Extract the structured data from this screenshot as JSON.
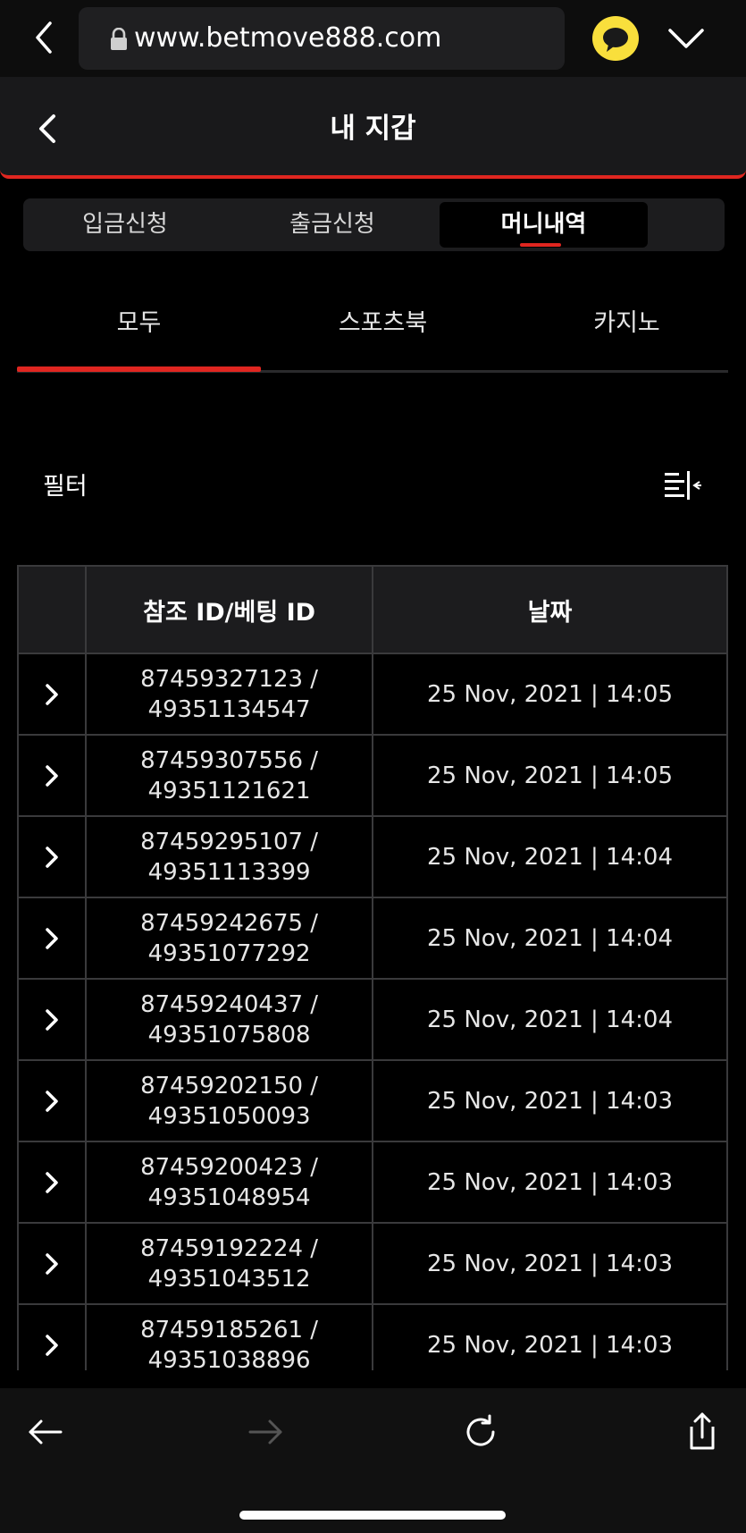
{
  "browser": {
    "url": "www.betmove888.com"
  },
  "header": {
    "title": "내 지갑"
  },
  "segment_tabs": [
    {
      "label": "입금신청",
      "active": false
    },
    {
      "label": "출금신청",
      "active": false
    },
    {
      "label": "머니내역",
      "active": true
    }
  ],
  "sub_tabs": [
    {
      "label": "모두",
      "active": true
    },
    {
      "label": "스포츠북",
      "active": false
    },
    {
      "label": "카지노",
      "active": false
    }
  ],
  "filter": {
    "label": "필터"
  },
  "table": {
    "columns": [
      "",
      "참조 ID/베팅 ID",
      "날짜"
    ],
    "rows": [
      {
        "ref_id": "87459327123 /",
        "bet_id": "49351134547",
        "date": "25 Nov, 2021 | 14:05"
      },
      {
        "ref_id": "87459307556 /",
        "bet_id": "49351121621",
        "date": "25 Nov, 2021 | 14:05"
      },
      {
        "ref_id": "87459295107 /",
        "bet_id": "49351113399",
        "date": "25 Nov, 2021 | 14:04"
      },
      {
        "ref_id": "87459242675 /",
        "bet_id": "49351077292",
        "date": "25 Nov, 2021 | 14:04"
      },
      {
        "ref_id": "87459240437 /",
        "bet_id": "49351075808",
        "date": "25 Nov, 2021 | 14:04"
      },
      {
        "ref_id": "87459202150 /",
        "bet_id": "49351050093",
        "date": "25 Nov, 2021 | 14:03"
      },
      {
        "ref_id": "87459200423 /",
        "bet_id": "49351048954",
        "date": "25 Nov, 2021 | 14:03"
      },
      {
        "ref_id": "87459192224 /",
        "bet_id": "49351043512",
        "date": "25 Nov, 2021 | 14:03"
      },
      {
        "ref_id": "87459185261 /",
        "bet_id": "49351038896",
        "date": "25 Nov, 2021 | 14:03"
      }
    ]
  },
  "colors": {
    "accent": "#e02620",
    "kakao": "#f9df3c",
    "background": "#000000",
    "header_bg": "#19191b"
  },
  "icons": {
    "top_back": "chevron-left-icon",
    "lock": "lock-icon",
    "kakao": "kakao-talk-icon",
    "menu": "chevron-down-icon",
    "header_back": "chevron-left-icon",
    "filter": "filter-sort-icon",
    "row_expand": "chevron-right-icon",
    "bottom_back": "arrow-left-icon",
    "bottom_forward": "arrow-right-icon",
    "reload": "reload-icon",
    "share": "share-icon"
  }
}
